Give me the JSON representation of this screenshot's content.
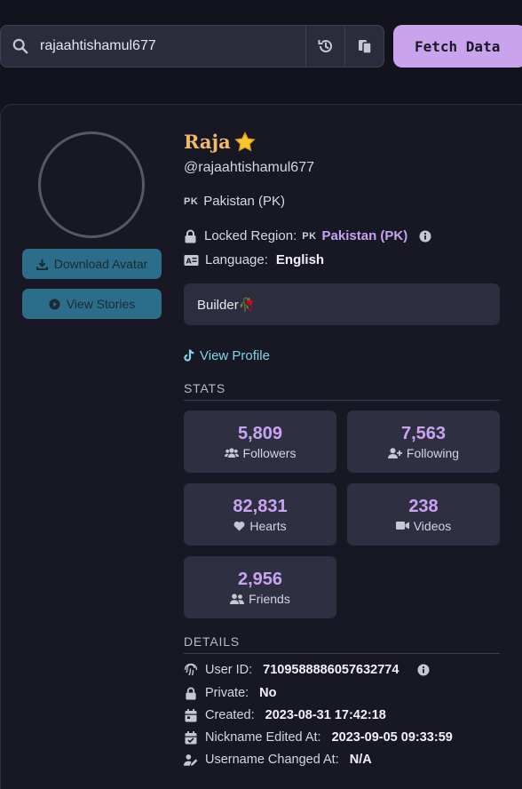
{
  "search": {
    "value": "rajaahtishamul677",
    "fetch_label": "Fetch Data"
  },
  "profile": {
    "nickname": "Raja",
    "username": "@rajaahtishamul677",
    "country_code": "PK",
    "country": "Pakistan (PK)",
    "locked_region_label": "Locked Region:",
    "locked_region_code": "PK",
    "locked_region_value": "Pakistan (PK)",
    "language_label": "Language:",
    "language_value": "English",
    "bio": "Builder🥀",
    "view_profile": "View Profile",
    "download_avatar": "Download Avatar",
    "view_stories": "View Stories"
  },
  "stats": {
    "title": "STATS",
    "items": [
      {
        "value": "5,809",
        "label": "Followers",
        "icon": "users-icon"
      },
      {
        "value": "7,563",
        "label": "Following",
        "icon": "user-plus-icon"
      },
      {
        "value": "82,831",
        "label": "Hearts",
        "icon": "heart-icon"
      },
      {
        "value": "238",
        "label": "Videos",
        "icon": "video-icon"
      },
      {
        "value": "2,956",
        "label": "Friends",
        "icon": "friends-icon"
      }
    ]
  },
  "details": {
    "title": "DETAILS",
    "items": [
      {
        "label": "User ID:",
        "value": "7109588886057632774",
        "icon": "fingerprint-icon"
      },
      {
        "label": "Private:",
        "value": "No",
        "icon": "lock-icon"
      },
      {
        "label": "Created:",
        "value": "2023-08-31 17:42:18",
        "icon": "calendar-icon"
      },
      {
        "label": "Nickname Edited At:",
        "value": "2023-09-05 09:33:59",
        "icon": "calendar-check-icon"
      },
      {
        "label": "Username Changed At:",
        "value": "N/A",
        "icon": "user-edit-icon"
      }
    ]
  },
  "colors": {
    "background": "#13131d",
    "accent": "#c9a4ec",
    "nickname": "#f3b96b",
    "link": "#7fd6e6",
    "button": "#2c6e89"
  }
}
